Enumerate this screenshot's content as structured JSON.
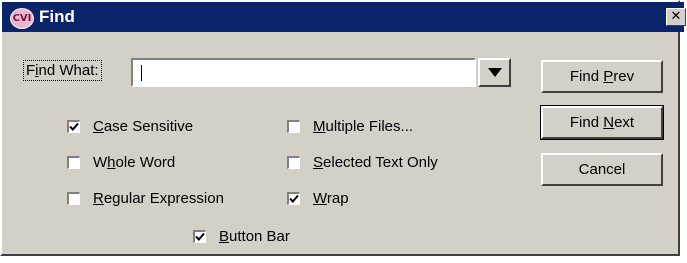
{
  "window": {
    "title": "Find",
    "icon_text": "CVI",
    "close_glyph": "✕"
  },
  "find_what": {
    "label_prefix": "F",
    "label_accel": "i",
    "label_suffix": "nd What:",
    "value": ""
  },
  "buttons": {
    "find_prev": {
      "prefix": "Find ",
      "accel": "P",
      "suffix": "rev"
    },
    "find_next": {
      "prefix": "Find ",
      "accel": "N",
      "suffix": "ext"
    },
    "cancel": {
      "prefix": "",
      "accel": "",
      "suffix": "Cancel"
    }
  },
  "options": {
    "case_sensitive": {
      "prefix": "",
      "accel": "C",
      "suffix": "ase Sensitive",
      "checked": true
    },
    "whole_word": {
      "prefix": "W",
      "accel": "h",
      "suffix": "ole Word",
      "checked": false
    },
    "regular_expression": {
      "prefix": "",
      "accel": "R",
      "suffix": "egular Expression",
      "checked": false
    },
    "multiple_files": {
      "prefix": "",
      "accel": "M",
      "suffix": "ultiple Files...",
      "checked": false
    },
    "selected_text_only": {
      "prefix": "",
      "accel": "S",
      "suffix": "elected Text Only",
      "checked": false
    },
    "wrap": {
      "prefix": "",
      "accel": "W",
      "suffix": "rap",
      "checked": true
    },
    "button_bar": {
      "prefix": "",
      "accel": "B",
      "suffix": "utton Bar",
      "checked": true
    }
  },
  "colors": {
    "titlebar": "#0a246a",
    "dialog_face": "#d4d0c8"
  },
  "icons": {
    "app": "cvi-app-icon",
    "close": "close-icon",
    "dropdown": "triangle-down-icon",
    "check": "checkmark-icon"
  }
}
